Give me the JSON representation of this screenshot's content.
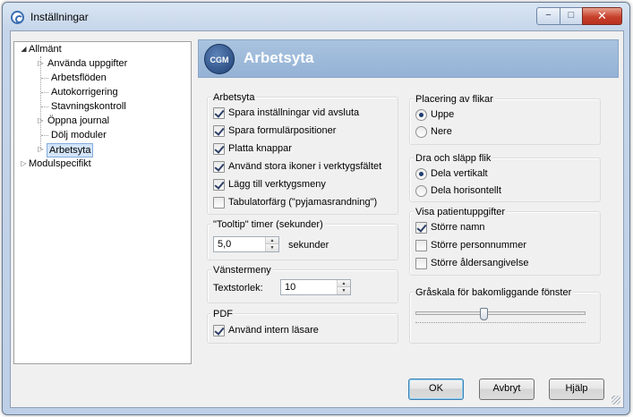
{
  "window": {
    "title": "Inställningar",
    "minimize": "−",
    "maximize": "□",
    "close": "✕"
  },
  "tree": {
    "root1": {
      "label": "Allmänt",
      "expanded": true
    },
    "items": [
      {
        "label": "Använda uppgifter",
        "expandable": true
      },
      {
        "label": "Arbetsflöden",
        "expandable": false
      },
      {
        "label": "Autokorrigering",
        "expandable": false
      },
      {
        "label": "Stavningskontroll",
        "expandable": false
      },
      {
        "label": "Öppna journal",
        "expandable": true
      },
      {
        "label": "Dölj moduler",
        "expandable": false
      },
      {
        "label": "Arbetsyta",
        "expandable": true,
        "selected": true
      }
    ],
    "root2": {
      "label": "Modulspecifikt",
      "expanded": false
    }
  },
  "header": {
    "logo": "CGM",
    "title": "Arbetsyta",
    "color": "#9db8d9"
  },
  "arbetsyta": {
    "legend": "Arbetsyta",
    "options": [
      {
        "label": "Spara inställningar vid avsluta",
        "checked": true
      },
      {
        "label": "Spara formulärpositioner",
        "checked": true
      },
      {
        "label": "Platta knappar",
        "checked": true
      },
      {
        "label": "Använd stora ikoner i verktygsfältet",
        "checked": true
      },
      {
        "label": "Lägg till verktygsmeny",
        "checked": true
      },
      {
        "label": "Tabulatorfärg (\"pyjamasrandning\")",
        "checked": false
      }
    ]
  },
  "tooltip": {
    "legend": "\"Tooltip\" timer (sekunder)",
    "value": "5,0",
    "unit": "sekunder"
  },
  "vanstermeny": {
    "legend": "Vänstermeny",
    "label": "Textstorlek:",
    "value": "10"
  },
  "pdf": {
    "legend": "PDF",
    "option": {
      "label": "Använd intern läsare",
      "checked": true
    }
  },
  "placering": {
    "legend": "Placering av flikar",
    "options": [
      {
        "label": "Uppe",
        "selected": true
      },
      {
        "label": "Nere",
        "selected": false
      }
    ]
  },
  "drasapp": {
    "legend": "Dra och släpp flik",
    "options": [
      {
        "label": "Dela vertikalt",
        "selected": true
      },
      {
        "label": "Dela horisontellt",
        "selected": false
      }
    ]
  },
  "patient": {
    "legend": "Visa patientuppgifter",
    "options": [
      {
        "label": "Större namn",
        "checked": true
      },
      {
        "label": "Större personnummer",
        "checked": false
      },
      {
        "label": "Större åldersangivelse",
        "checked": false
      }
    ]
  },
  "gray": {
    "legend": "Gråskala för bakomliggande fönster",
    "level": 0.4
  },
  "buttons": {
    "ok": "OK",
    "cancel": "Avbryt",
    "help": "Hjälp"
  }
}
